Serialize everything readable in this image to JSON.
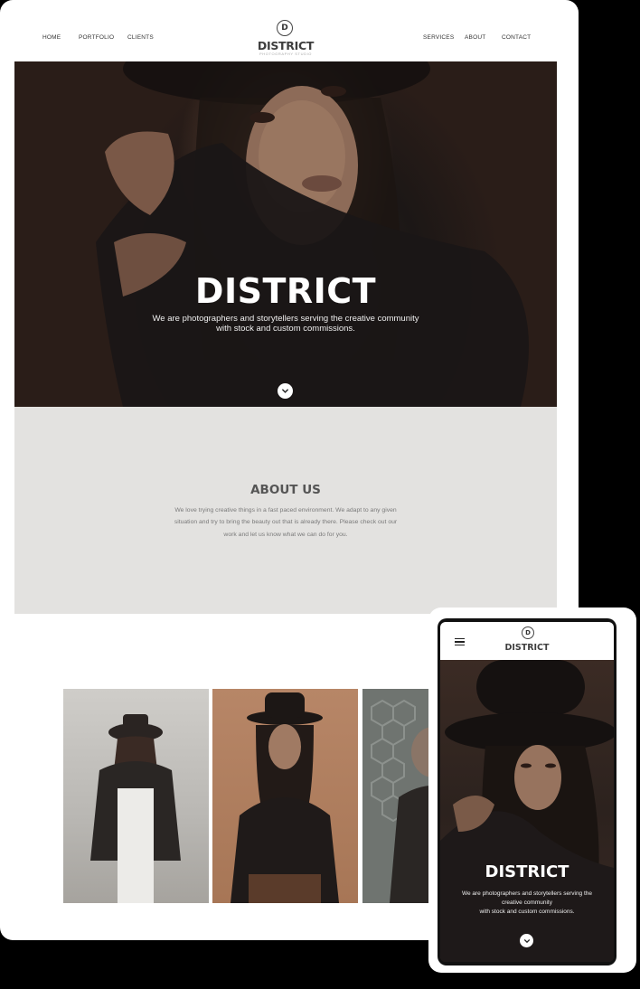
{
  "desktop": {
    "nav_left": [
      "HOME",
      "PORTFOLIO",
      "CLIENTS"
    ],
    "nav_right": [
      "SERVICES",
      "ABOUT",
      "CONTACT"
    ],
    "logo_letter": "D",
    "logo_name": "DISTRICT",
    "logo_tagline": "photography studio",
    "hero": {
      "title": "DISTRICT",
      "subtitle_line1": "We are photographers and storytellers serving the creative community",
      "subtitle_line2": "with stock and custom commissions."
    },
    "about": {
      "title": "ABOUT US",
      "line1": "We love trying creative things in a fast paced environment. We adapt to any given",
      "line2": "situation and try to bring the beauty out that is already there. Please check out our",
      "line3": "work and let us know what we can do for you."
    }
  },
  "mobile": {
    "logo_letter": "D",
    "logo_name": "DISTRICT",
    "hero": {
      "title": "DISTRICT",
      "subtitle_line1": "We are photographers and storytellers serving the",
      "subtitle_line2": "creative community",
      "subtitle_line3": "with stock and custom commissions."
    }
  },
  "icons": {
    "scroll": "chevron-down-icon",
    "menu": "hamburger-menu-icon"
  },
  "colors": {
    "about_bg": "#e3e2e0",
    "hero_dark": "#2a1e19",
    "logo_text": "#3e3e3e"
  }
}
